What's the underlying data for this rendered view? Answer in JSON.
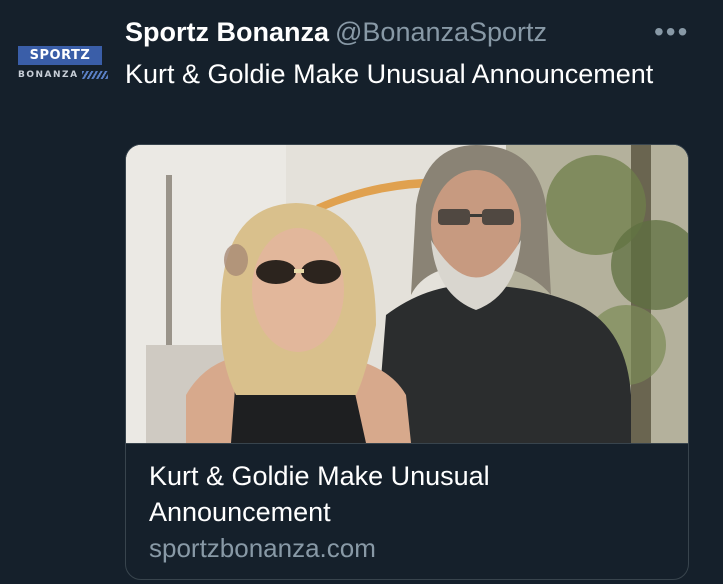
{
  "tweet": {
    "display_name": "Sportz Bonanza",
    "handle": "@BonanzaSportz",
    "text": "Kurt & Goldie Make Unusual Announcement",
    "more_icon": "more-horizontal-icon"
  },
  "avatar": {
    "logo_top": "SPORTZ",
    "logo_bottom": "BONANZA"
  },
  "card": {
    "title": "Kurt & Goldie Make Unusual Announcement",
    "domain": "sportzbonanza.com"
  },
  "colors": {
    "background": "#15202b",
    "secondary_text": "#8899a6",
    "border": "#38444d",
    "logo_blue": "#3a5ea8"
  }
}
